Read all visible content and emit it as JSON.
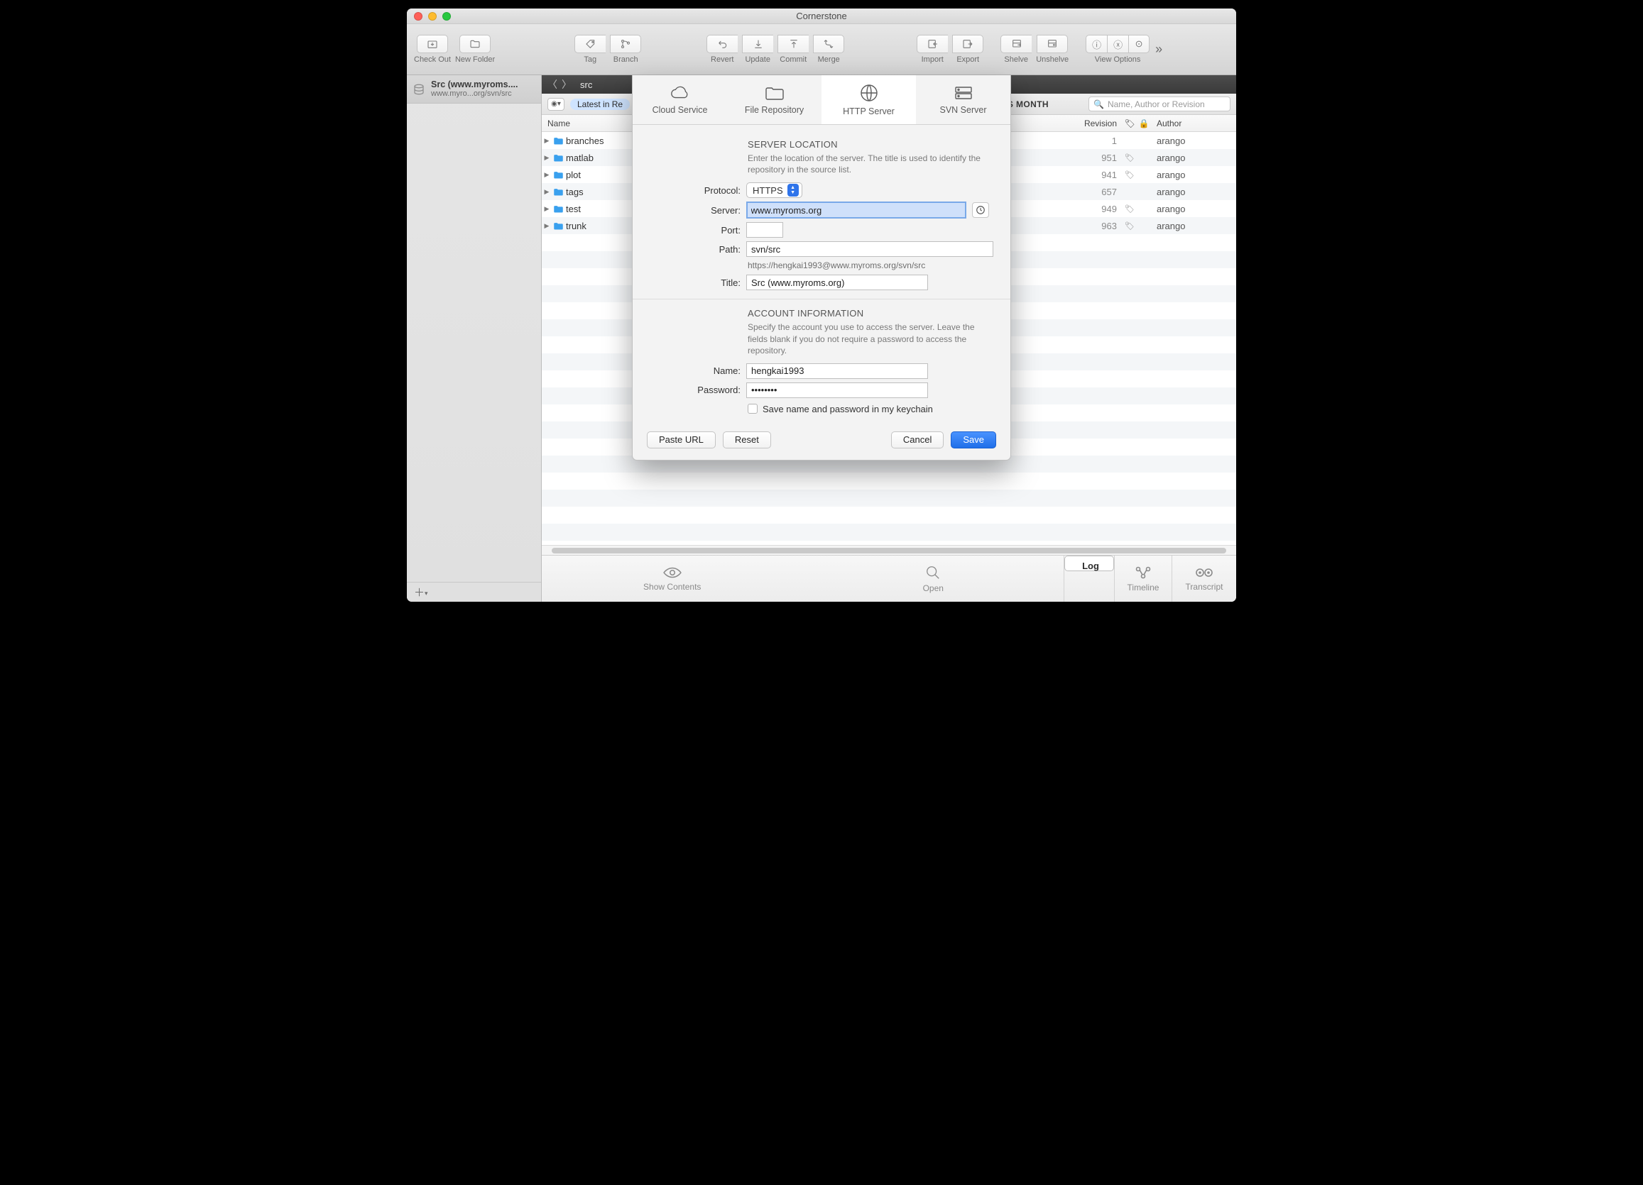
{
  "window": {
    "title": "Cornerstone"
  },
  "toolbar": {
    "checkout": "Check Out",
    "newfolder": "New Folder",
    "tag": "Tag",
    "branch": "Branch",
    "revert": "Revert",
    "update": "Update",
    "commit": "Commit",
    "merge": "Merge",
    "import": "Import",
    "export": "Export",
    "shelve": "Shelve",
    "unshelve": "Unshelve",
    "viewoptions": "View Options"
  },
  "sidebar": {
    "repo": {
      "title": "Src (www.myroms....",
      "subtitle": "www.myro...org/svn/src"
    }
  },
  "pathbar": {
    "path": "src"
  },
  "filter": {
    "pill": "Latest in Re",
    "label": "IS MONTH"
  },
  "search": {
    "placeholder": "Name, Author or Revision"
  },
  "columns": {
    "name": "Name",
    "revision": "Revision",
    "author": "Author"
  },
  "rows": [
    {
      "name": "branches",
      "rev": "1",
      "tag": "",
      "author": "arango"
    },
    {
      "name": "matlab",
      "rev": "951",
      "tag": "🏷",
      "author": "arango"
    },
    {
      "name": "plot",
      "rev": "941",
      "tag": "🏷",
      "author": "arango"
    },
    {
      "name": "tags",
      "rev": "657",
      "tag": "",
      "author": "arango"
    },
    {
      "name": "test",
      "rev": "949",
      "tag": "🏷",
      "author": "arango"
    },
    {
      "name": "trunk",
      "rev": "963",
      "tag": "🏷",
      "author": "arango"
    }
  ],
  "footer": {
    "show": "Show Contents",
    "open": "Open",
    "log": "Log",
    "timeline": "Timeline",
    "transcript": "Transcript"
  },
  "sheet": {
    "tabs": {
      "cloud": "Cloud Service",
      "file": "File Repository",
      "http": "HTTP Server",
      "svn": "SVN Server"
    },
    "loc": {
      "heading": "SERVER LOCATION",
      "desc": "Enter the location of the server. The title is used to identify the repository in the source list.",
      "protocol_l": "Protocol:",
      "protocol_v": "HTTPS",
      "server_l": "Server:",
      "server_v": "www.myroms.org",
      "port_l": "Port:",
      "port_v": "",
      "path_l": "Path:",
      "path_v": "svn/src",
      "url": "https://hengkai1993@www.myroms.org/svn/src",
      "title_l": "Title:",
      "title_v": "Src (www.myroms.org)"
    },
    "acct": {
      "heading": "ACCOUNT INFORMATION",
      "desc": "Specify the account you use to access the server. Leave the fields blank if you do not require a password to access the repository.",
      "name_l": "Name:",
      "name_v": "hengkai1993",
      "pass_l": "Password:",
      "pass_v": "••••••••",
      "keychain": "Save name and password in my keychain"
    },
    "buttons": {
      "paste": "Paste URL",
      "reset": "Reset",
      "cancel": "Cancel",
      "save": "Save"
    }
  }
}
